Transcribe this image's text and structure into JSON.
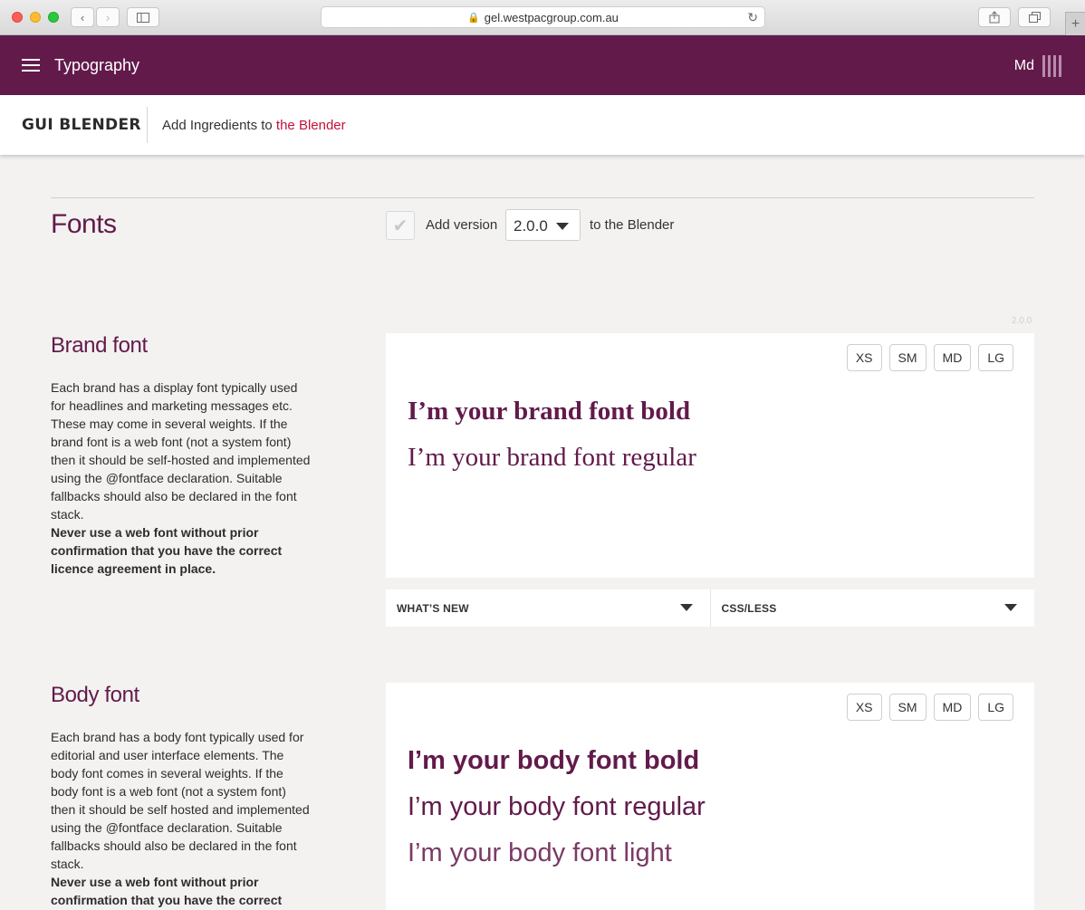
{
  "browser": {
    "url": "gel.westpacgroup.com.au"
  },
  "topbar": {
    "title": "Typography",
    "breakpoint": "Md"
  },
  "subbar": {
    "logo": "GUI BLENDER",
    "text_prefix": "Add Ingredients to ",
    "text_link": "the Blender"
  },
  "fonts": {
    "title": "Fonts",
    "add_version": "Add version",
    "version": "2.0.0",
    "to_blender": "to the Blender",
    "version_tag": "2.0.0"
  },
  "sizes": [
    "XS",
    "SM",
    "MD",
    "LG"
  ],
  "brand": {
    "title": "Brand font",
    "desc": "Each brand has a display font typically used for headlines and marketing messages etc. These may come in several weights. If the brand font is a web font (not a system font) then it should be self-hosted and implemented using the @fontface declaration. Suitable fallbacks should also be declared in the font stack.",
    "warning": "Never use a web font without prior confirmation that you have the correct licence agreement in place.",
    "sample_bold": "I’m your brand font bold",
    "sample_regular": "I’m your brand font regular",
    "whats_new": "WHAT’S NEW",
    "css_less": "CSS/LESS"
  },
  "body_font": {
    "title": "Body font",
    "desc": "Each brand has a body font typically used for editorial and user interface elements. The body font comes in several weights. If the body font is a web font (not a system font) then it should be self hosted and implemented using the @fontface declaration. Suitable fallbacks should also be declared in the font stack.",
    "warning": "Never use a web font without prior confirmation that you have the correct",
    "sample_bold": "I’m your body font bold",
    "sample_regular": "I’m your body font regular",
    "sample_light": "I’m your body font light"
  }
}
